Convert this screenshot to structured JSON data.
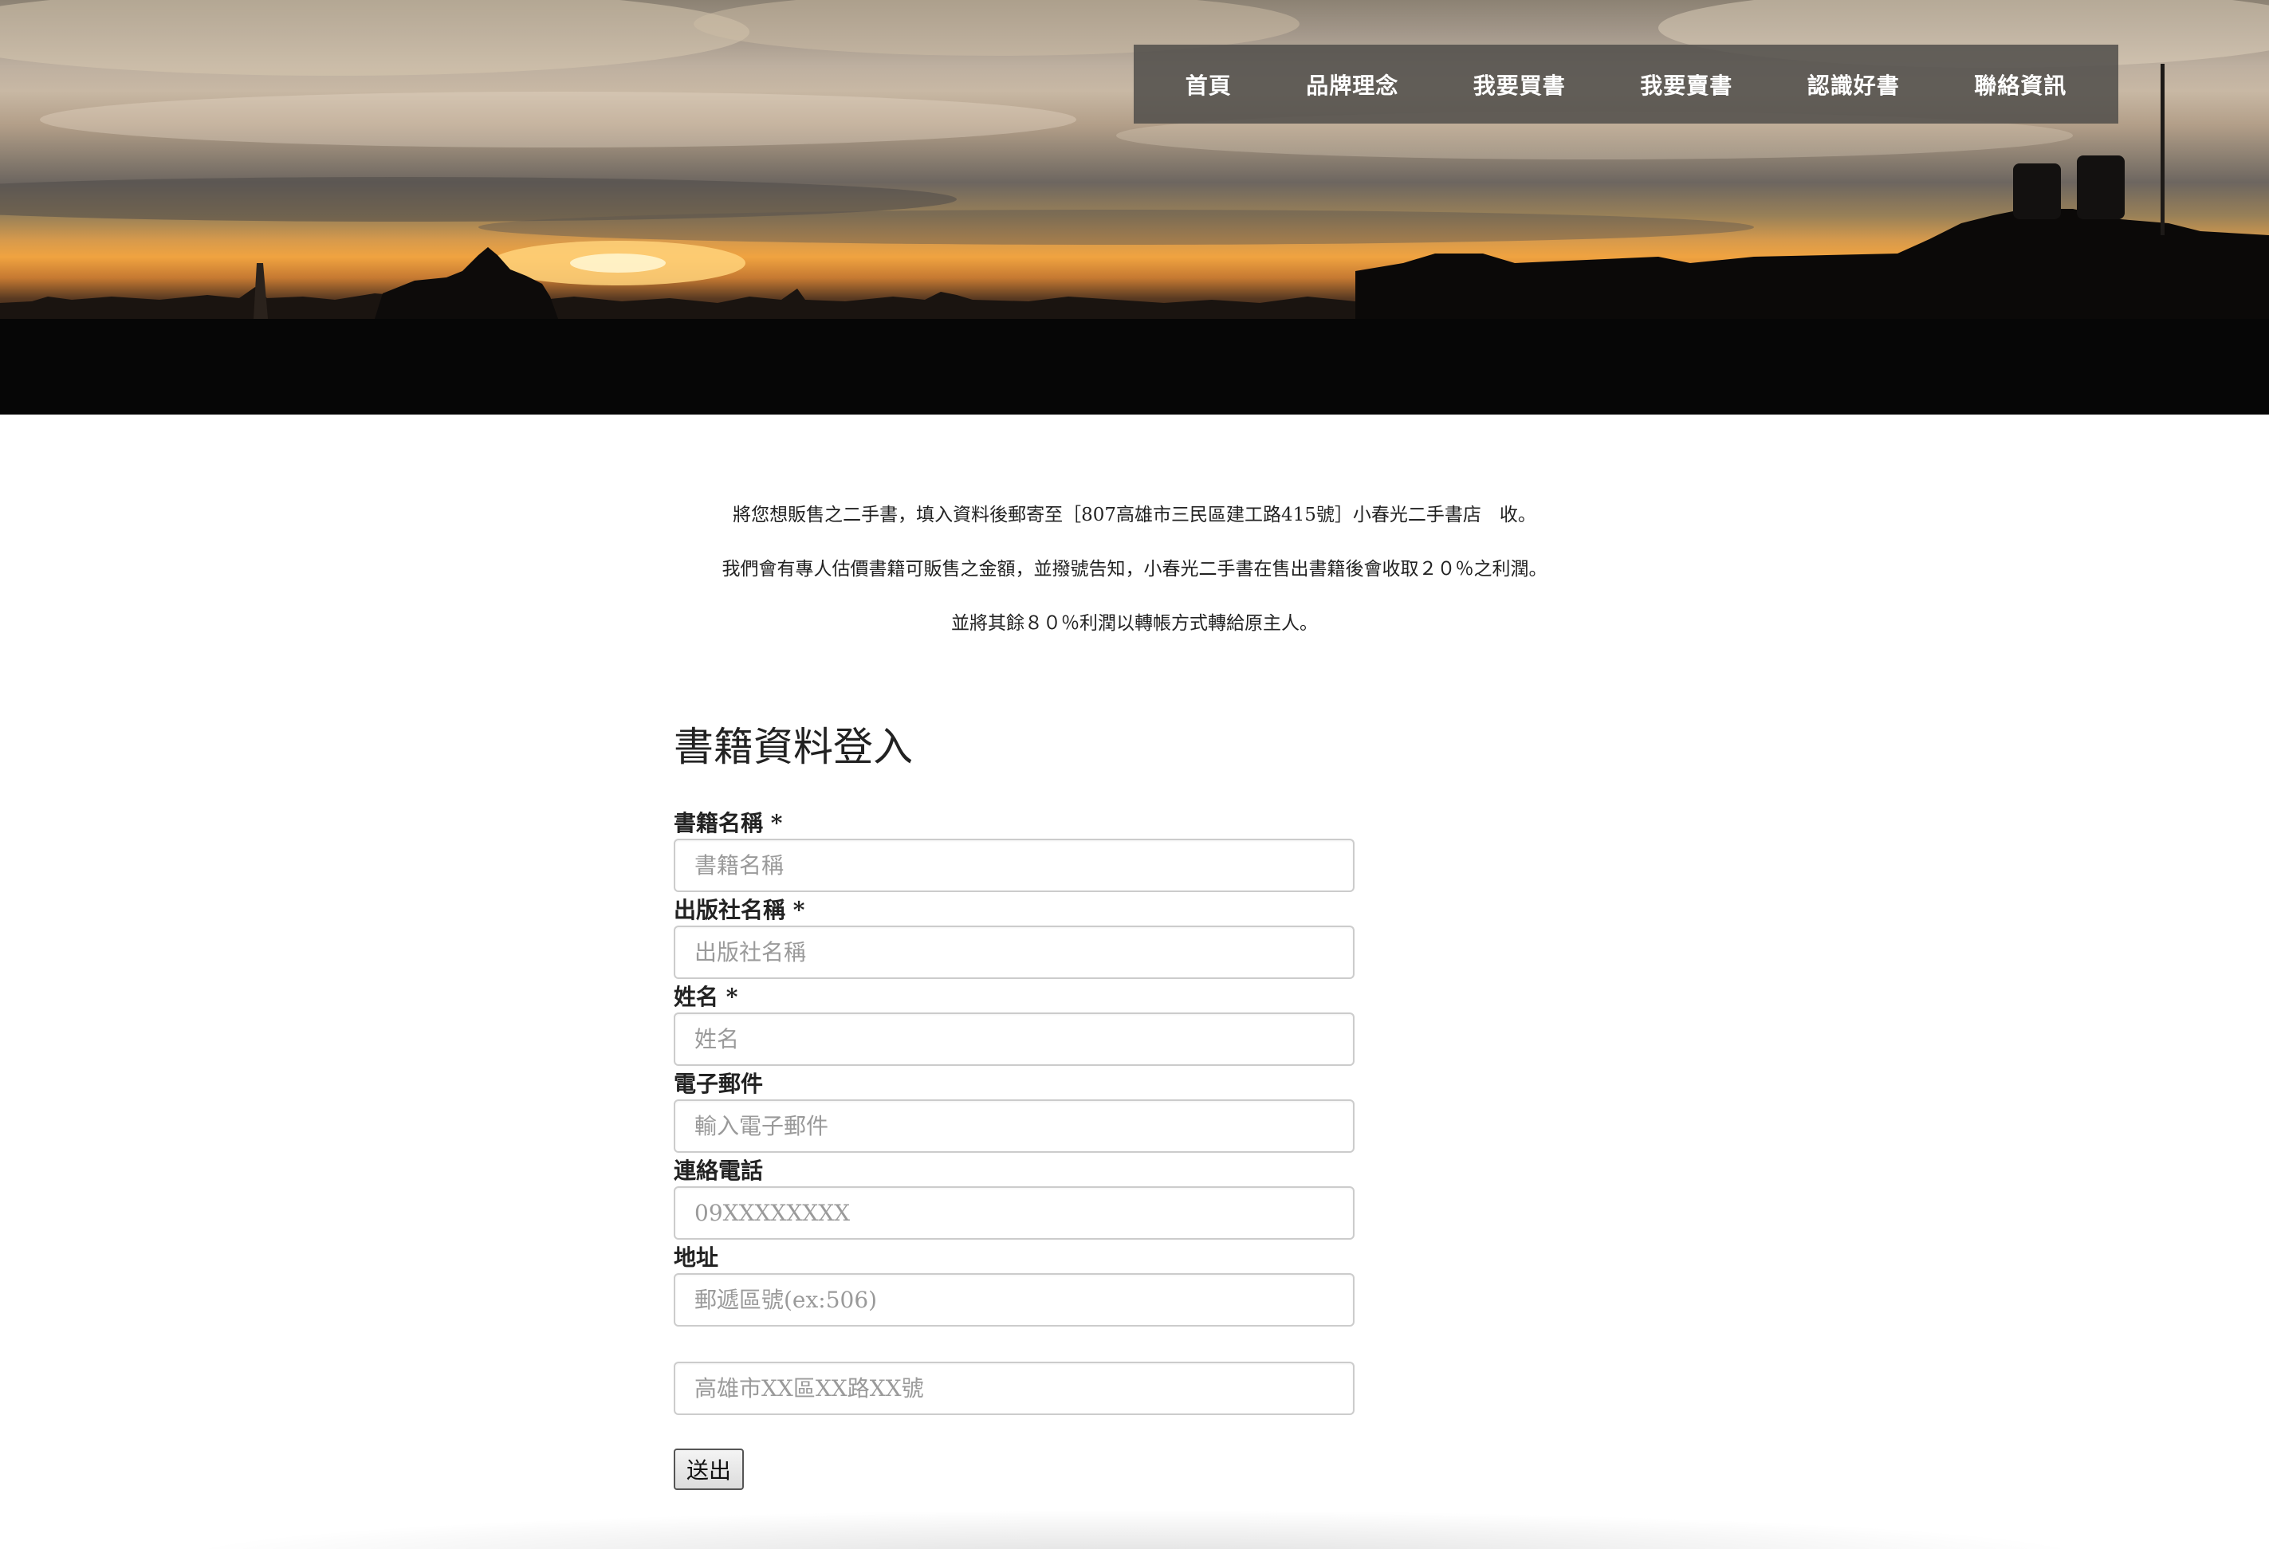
{
  "nav": {
    "items": [
      {
        "label": "首頁"
      },
      {
        "label": "品牌理念"
      },
      {
        "label": "我要買書"
      },
      {
        "label": "我要賣書"
      },
      {
        "label": "認識好書"
      },
      {
        "label": "聯絡資訊"
      }
    ]
  },
  "intro": {
    "lines": [
      "將您想販售之二手書，填入資料後郵寄至［807高雄市三民區建工路415號］小春光二手書店　收。",
      "我們會有專人估價書籍可販售之金額，並撥號告知，小春光二手書在售出書籍後會收取２０％之利潤。",
      "並將其餘８０％利潤以轉帳方式轉給原主人。"
    ]
  },
  "form": {
    "title": "書籍資料登入",
    "fields": [
      {
        "label": "書籍名稱 *",
        "placeholder": "書籍名稱",
        "value": ""
      },
      {
        "label": "出版社名稱 *",
        "placeholder": "出版社名稱",
        "value": ""
      },
      {
        "label": "姓名 *",
        "placeholder": "姓名",
        "value": ""
      },
      {
        "label": "電子郵件",
        "placeholder": "輸入電子郵件",
        "value": ""
      },
      {
        "label": "連絡電話",
        "placeholder": "09XXXXXXXX",
        "value": ""
      },
      {
        "label": "地址",
        "placeholder": "郵遞區號(ex:506)",
        "value": ""
      }
    ],
    "address_line2_placeholder": "高雄市XX區XX路XX號",
    "submit_label": "送出"
  }
}
